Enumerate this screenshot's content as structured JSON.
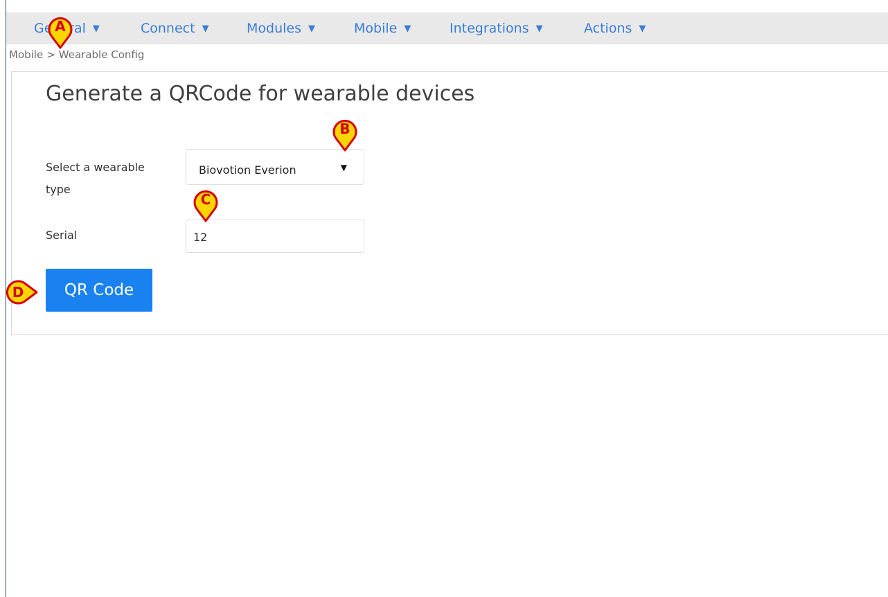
{
  "nav": {
    "items": [
      {
        "label": "General",
        "caret": "▼"
      },
      {
        "label": "Connect",
        "caret": "▼"
      },
      {
        "label": "Modules",
        "caret": "▼"
      },
      {
        "label": "Mobile",
        "caret": "▼"
      },
      {
        "label": "Integrations",
        "caret": "▼"
      },
      {
        "label": "Actions",
        "caret": "▼"
      }
    ]
  },
  "breadcrumb": {
    "parent": "Mobile",
    "separator": ">",
    "current": "Wearable Config"
  },
  "page": {
    "title": "Generate a QRCode for wearable devices"
  },
  "form": {
    "wearable_label_line1": "Select a wearable",
    "wearable_label_line2": "type",
    "wearable_value": "Biovotion Everion",
    "serial_label": "Serial",
    "serial_value": "12",
    "submit_label": "QR Code"
  },
  "markers": {
    "a": "A",
    "b": "B",
    "c": "C",
    "d": "D"
  },
  "colors": {
    "nav_link": "#3a7dd6",
    "button": "#1a82f0",
    "marker_fill": "#ffd500",
    "marker_outline": "#d60000"
  }
}
